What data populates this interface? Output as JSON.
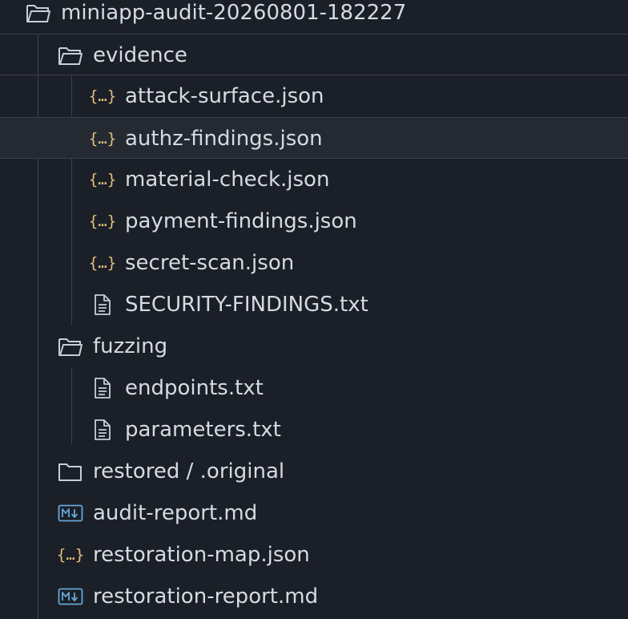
{
  "explorer": {
    "root": {
      "label": "miniapp-audit-20260801-182227",
      "icon": "folder-open-icon"
    },
    "evidence": {
      "label": "evidence",
      "icon": "folder-open-icon",
      "items": [
        {
          "label": "attack-surface.json",
          "icon": "json-icon"
        },
        {
          "label": "authz-findings.json",
          "icon": "json-icon",
          "selected": true
        },
        {
          "label": "material-check.json",
          "icon": "json-icon"
        },
        {
          "label": "payment-findings.json",
          "icon": "json-icon"
        },
        {
          "label": "secret-scan.json",
          "icon": "json-icon"
        },
        {
          "label": "SECURITY-FINDINGS.txt",
          "icon": "text-file-icon"
        }
      ]
    },
    "fuzzing": {
      "label": "fuzzing",
      "icon": "folder-open-icon",
      "items": [
        {
          "label": "endpoints.txt",
          "icon": "text-file-icon"
        },
        {
          "label": "parameters.txt",
          "icon": "text-file-icon"
        }
      ]
    },
    "restored": {
      "label": "restored / .original",
      "icon": "folder-closed-icon"
    },
    "audit_report": {
      "label": "audit-report.md",
      "icon": "markdown-icon"
    },
    "restoration_map": {
      "label": "restoration-map.json",
      "icon": "json-icon"
    },
    "restoration_report": {
      "label": "restoration-report.md",
      "icon": "markdown-icon"
    }
  },
  "colors": {
    "background": "#1b1f27",
    "selected_row": "#242932",
    "text": "#d6dbe3",
    "json_icon": "#e2c07b",
    "markdown_icon": "#63a8d6",
    "folder_icon": "#c8ced8"
  }
}
